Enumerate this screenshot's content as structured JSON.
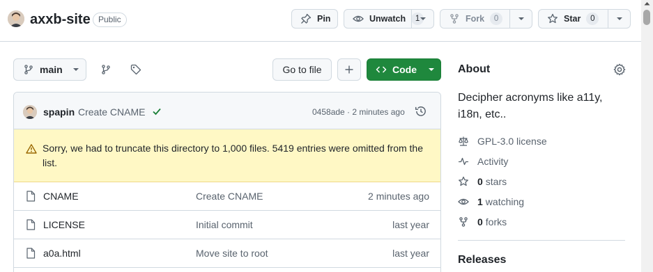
{
  "repo": {
    "name": "axxb-site",
    "visibility": "Public"
  },
  "header_actions": {
    "pin_label": "Pin",
    "watch_label": "Unwatch",
    "watch_count": "1",
    "fork_label": "Fork",
    "fork_count": "0",
    "star_label": "Star",
    "star_count": "0"
  },
  "toolbar": {
    "branch": "main",
    "go_to_file": "Go to file",
    "add_icon": "plus-icon",
    "code_label": "Code"
  },
  "latest_commit": {
    "author": "spapin",
    "message": "Create CNAME",
    "meta": "0458ade · 2 minutes ago",
    "status": "success"
  },
  "warning": {
    "text": "Sorry, we had to truncate this directory to 1,000 files. 5419 entries were omitted from the list."
  },
  "files": [
    {
      "name": "CNAME",
      "message": "Create CNAME",
      "time": "2 minutes ago"
    },
    {
      "name": "LICENSE",
      "message": "Initial commit",
      "time": "last year"
    },
    {
      "name": "a0a.html",
      "message": "Move site to root",
      "time": "last year"
    }
  ],
  "about": {
    "title": "About",
    "description": "Decipher acronyms like a11y, i18n, etc..",
    "license": "GPL-3.0 license",
    "activity": "Activity",
    "stars_count": "0",
    "stars_label": "stars",
    "watching_count": "1",
    "watching_label": "watching",
    "forks_count": "0",
    "forks_label": "forks",
    "releases_title": "Releases"
  },
  "colors": {
    "accent_green": "#1f883d",
    "warning_bg": "#fff8c5",
    "warning_icon": "#9a6700",
    "success": "#1a7f37"
  }
}
